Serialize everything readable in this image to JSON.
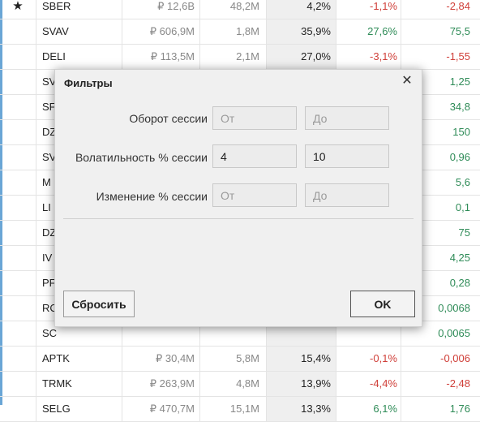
{
  "table": {
    "rows": [
      {
        "star": "★",
        "ticker": "SBER",
        "turnover": "₽ 12,6B",
        "volume": "48,2M",
        "volatility": "4,2%",
        "change": "-1,1%",
        "change_dir": "neg",
        "abs": "-2,84",
        "abs_dir": "neg"
      },
      {
        "star": "",
        "ticker": "SVAV",
        "turnover": "₽ 606,9M",
        "volume": "1,8M",
        "volatility": "35,9%",
        "change": "27,6%",
        "change_dir": "pos",
        "abs": "75,5",
        "abs_dir": "pos"
      },
      {
        "star": "",
        "ticker": "DELI",
        "turnover": "₽ 113,5M",
        "volume": "2,1M",
        "volatility": "27,0%",
        "change": "-3,1%",
        "change_dir": "neg",
        "abs": "-1,55",
        "abs_dir": "neg"
      },
      {
        "star": "",
        "ticker": "SV",
        "turnover": "",
        "volume": "",
        "volatility": "",
        "change": "",
        "change_dir": "pos",
        "abs": "1,25",
        "abs_dir": "pos"
      },
      {
        "star": "",
        "ticker": "SF",
        "turnover": "",
        "volume": "",
        "volatility": "",
        "change": "",
        "change_dir": "pos",
        "abs": "34,8",
        "abs_dir": "pos"
      },
      {
        "star": "",
        "ticker": "DZ",
        "turnover": "",
        "volume": "",
        "volatility": "",
        "change": "",
        "change_dir": "pos",
        "abs": "150",
        "abs_dir": "pos"
      },
      {
        "star": "",
        "ticker": "SV",
        "turnover": "",
        "volume": "",
        "volatility": "",
        "change": "",
        "change_dir": "pos",
        "abs": "0,96",
        "abs_dir": "pos"
      },
      {
        "star": "",
        "ticker": "M",
        "turnover": "",
        "volume": "",
        "volatility": "",
        "change": "",
        "change_dir": "pos",
        "abs": "5,6",
        "abs_dir": "pos"
      },
      {
        "star": "",
        "ticker": "LI",
        "turnover": "",
        "volume": "",
        "volatility": "",
        "change": "",
        "change_dir": "pos",
        "abs": "0,1",
        "abs_dir": "pos"
      },
      {
        "star": "",
        "ticker": "DZ",
        "turnover": "",
        "volume": "",
        "volatility": "",
        "change": "",
        "change_dir": "pos",
        "abs": "75",
        "abs_dir": "pos"
      },
      {
        "star": "",
        "ticker": "IV",
        "turnover": "",
        "volume": "",
        "volatility": "",
        "change": "",
        "change_dir": "pos",
        "abs": "4,25",
        "abs_dir": "pos"
      },
      {
        "star": "",
        "ticker": "PF",
        "turnover": "",
        "volume": "",
        "volatility": "",
        "change": "",
        "change_dir": "pos",
        "abs": "0,28",
        "abs_dir": "pos"
      },
      {
        "star": "",
        "ticker": "RC",
        "turnover": "",
        "volume": "",
        "volatility": "",
        "change": "",
        "change_dir": "pos",
        "abs": "0,0068",
        "abs_dir": "pos"
      },
      {
        "star": "",
        "ticker": "SC",
        "turnover": "",
        "volume": "",
        "volatility": "",
        "change": "",
        "change_dir": "pos",
        "abs": "0,0065",
        "abs_dir": "pos"
      },
      {
        "star": "",
        "ticker": "APTK",
        "turnover": "₽ 30,4M",
        "volume": "5,8M",
        "volatility": "15,4%",
        "change": "-0,1%",
        "change_dir": "neg",
        "abs": "-0,006",
        "abs_dir": "neg"
      },
      {
        "star": "",
        "ticker": "TRMK",
        "turnover": "₽ 263,9M",
        "volume": "4,8M",
        "volatility": "13,9%",
        "change": "-4,4%",
        "change_dir": "neg",
        "abs": "-2,48",
        "abs_dir": "neg"
      },
      {
        "star": "",
        "ticker": "SELG",
        "turnover": "₽ 470,7M",
        "volume": "15,1M",
        "volatility": "13,3%",
        "change": "6,1%",
        "change_dir": "pos",
        "abs": "1,76",
        "abs_dir": "pos"
      }
    ]
  },
  "dialog": {
    "title": "Фильтры",
    "close_icon": "close-icon",
    "filters": [
      {
        "label": "Оборот сессии",
        "from_value": "",
        "from_placeholder": "От",
        "to_value": "",
        "to_placeholder": "До"
      },
      {
        "label": "Волатильность % сессии",
        "from_value": "4",
        "from_placeholder": "От",
        "to_value": "10",
        "to_placeholder": "До"
      },
      {
        "label": "Изменение % сессии",
        "from_value": "",
        "from_placeholder": "От",
        "to_value": "",
        "to_placeholder": "До"
      }
    ],
    "reset_label": "Сбросить",
    "ok_label": "OK"
  },
  "colors": {
    "positive": "#2e8b57",
    "negative": "#d0403a",
    "accent": "#6aa6d6"
  }
}
